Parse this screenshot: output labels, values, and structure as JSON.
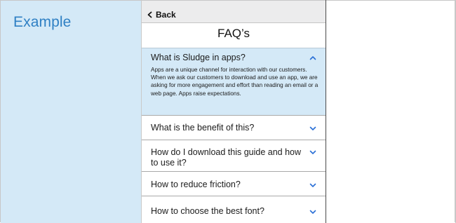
{
  "example_label": "Example",
  "header": {
    "back_label": "Back",
    "title": "FAQ’s"
  },
  "faqs": [
    {
      "question": "What is Sludge in apps?",
      "answer": "Apps are a unique channel for interaction with our customers. When we ask our customers to download and use an app, we are asking for more engagement and effort than reading an email or a web page. Apps raise expectations.",
      "expanded": true
    },
    {
      "question": "What is the benefit of this?",
      "expanded": false
    },
    {
      "question": "How do I download this guide and how to use it?",
      "expanded": false
    },
    {
      "question": "How to reduce friction?",
      "expanded": false
    },
    {
      "question": "How to choose the best font?",
      "expanded": false
    }
  ],
  "colors": {
    "accent": "#2f80c4",
    "panel": "#d4e9f7",
    "chevron": "#2a6fd6"
  },
  "icons": {
    "back": "chevron-left-icon",
    "expand": "chevron-down-icon",
    "collapse": "chevron-up-icon"
  }
}
